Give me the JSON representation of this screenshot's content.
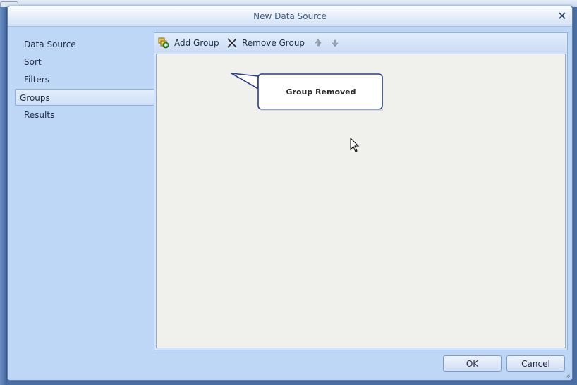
{
  "window": {
    "title": "New Data Source"
  },
  "sidebar": {
    "items": [
      {
        "label": "Data Source",
        "selected": false
      },
      {
        "label": "Sort",
        "selected": false
      },
      {
        "label": "Filters",
        "selected": false
      },
      {
        "label": "Groups",
        "selected": true
      },
      {
        "label": "Results",
        "selected": false
      }
    ]
  },
  "toolbar": {
    "add_group_label": "Add Group",
    "remove_group_label": "Remove Group",
    "add_group_icon": "add-group-icon",
    "remove_group_icon": "remove-x-icon",
    "move_up_icon": "arrow-up-icon",
    "move_down_icon": "arrow-down-icon"
  },
  "callout": {
    "text": "Group Removed"
  },
  "footer": {
    "ok_label": "OK",
    "cancel_label": "Cancel"
  },
  "colors": {
    "dialog_bg": "#bfd7f7",
    "canvas_bg": "#f0f0ec",
    "callout_border": "#2a3a8c",
    "title_text": "#3d5a84"
  }
}
